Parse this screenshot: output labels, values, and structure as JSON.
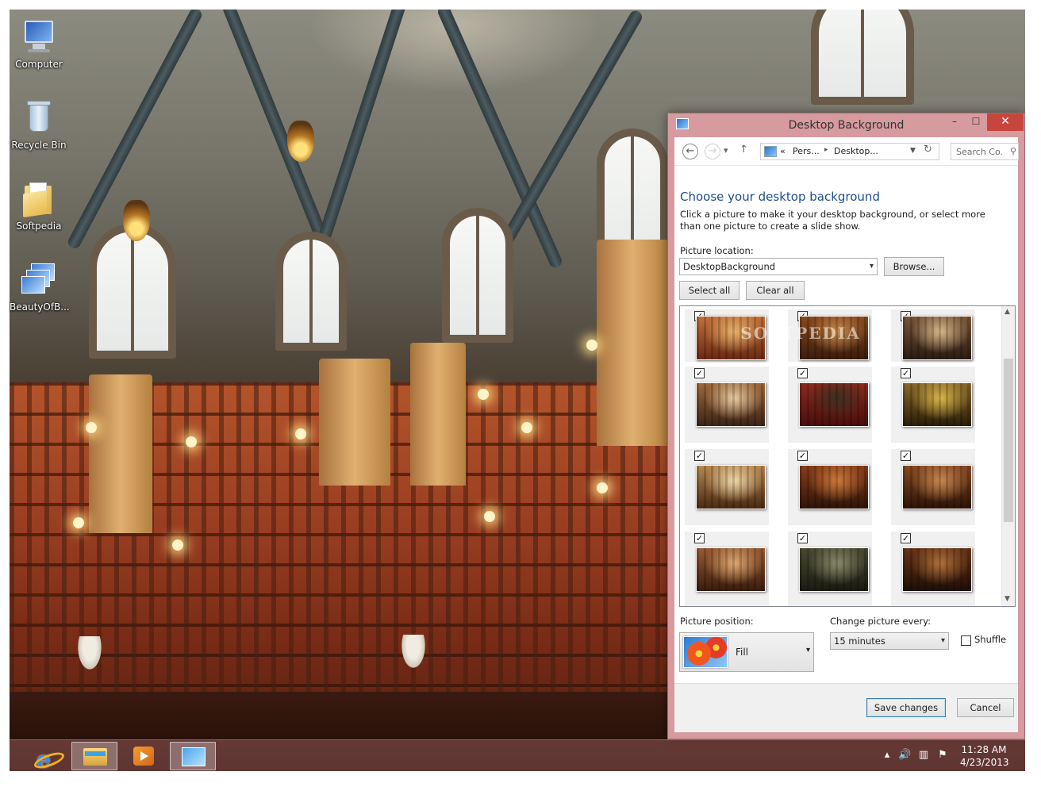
{
  "desktop": {
    "icons": [
      {
        "label": "Computer",
        "icon": "computer-icon"
      },
      {
        "label": "Recycle Bin",
        "icon": "recycle-bin-icon"
      },
      {
        "label": "Softpedia",
        "icon": "folder-icon"
      },
      {
        "label": "BeautyOfB...",
        "icon": "theme-pack-icon"
      }
    ]
  },
  "window": {
    "title": "Desktop Background",
    "caption_buttons": {
      "minimize": "–",
      "maximize": "☐",
      "close": "✕"
    },
    "nav": {
      "back": "←",
      "forward": "→",
      "recent": "▾",
      "up": "↑",
      "breadcrumb_prefix": "«",
      "breadcrumb": [
        "Pers...",
        "Desktop..."
      ],
      "refresh": "↻",
      "search_placeholder": "Search Co..."
    },
    "heading": "Choose your desktop background",
    "description": "Click a picture to make it your desktop background, or select more than one picture to create a slide show.",
    "picture_location": {
      "label": "Picture location:",
      "value": "DesktopBackground",
      "browse": "Browse..."
    },
    "select_all": "Select all",
    "clear_all": "Clear all",
    "thumbnails": [
      {
        "checked": true,
        "colors": [
          "#6b2a14",
          "#c2703a",
          "#e7b26a"
        ]
      },
      {
        "checked": true,
        "colors": [
          "#3b1c0c",
          "#8a4a1f",
          "#c98a4a"
        ]
      },
      {
        "checked": true,
        "colors": [
          "#2a1b12",
          "#7a5638",
          "#d8b88a"
        ]
      },
      {
        "checked": true,
        "colors": [
          "#3c2416",
          "#a0683a",
          "#e8caa0"
        ]
      },
      {
        "checked": true,
        "colors": [
          "#4a0f0c",
          "#8c2a1e",
          "#3d3020"
        ]
      },
      {
        "checked": true,
        "colors": [
          "#2a1d08",
          "#8a6a2a",
          "#d9b54a"
        ]
      },
      {
        "checked": true,
        "colors": [
          "#4a2a12",
          "#b88850",
          "#f0d8a8"
        ]
      },
      {
        "checked": true,
        "colors": [
          "#2e1408",
          "#8a3e1a",
          "#d07a3a"
        ]
      },
      {
        "checked": true,
        "colors": [
          "#2c1408",
          "#8a4a22",
          "#c88850"
        ]
      },
      {
        "checked": true,
        "colors": [
          "#3a1c0e",
          "#9a5a32",
          "#e0a870"
        ]
      },
      {
        "checked": true,
        "colors": [
          "#1a1a12",
          "#4a4a32",
          "#8a8a6a"
        ]
      },
      {
        "checked": true,
        "colors": [
          "#1e0e06",
          "#6a3418",
          "#b0703a"
        ]
      }
    ],
    "picture_position": {
      "label": "Picture position:",
      "value": "Fill"
    },
    "change_picture": {
      "label": "Change picture every:",
      "value": "15 minutes"
    },
    "shuffle": {
      "label": "Shuffle",
      "checked": false
    },
    "save": "Save changes",
    "cancel": "Cancel",
    "watermark": "SOFTPEDIA"
  },
  "taskbar": {
    "apps": [
      {
        "name": "Internet Explorer",
        "icon": "internet-explorer-icon",
        "active": false
      },
      {
        "name": "File Explorer",
        "icon": "file-explorer-icon",
        "active": true
      },
      {
        "name": "Windows Media Player",
        "icon": "media-player-icon",
        "active": false
      },
      {
        "name": "Control Panel",
        "icon": "control-panel-icon",
        "active": true
      }
    ],
    "tray": {
      "show_hidden": "▴",
      "volume": "🔊",
      "network": "▥",
      "action_center": "⚑"
    },
    "time": "11:28 AM",
    "date": "4/23/2013"
  },
  "colors": {
    "window_frame": "#d69a9f",
    "heading": "#1e4e8c",
    "close_button": "#c7453c"
  }
}
